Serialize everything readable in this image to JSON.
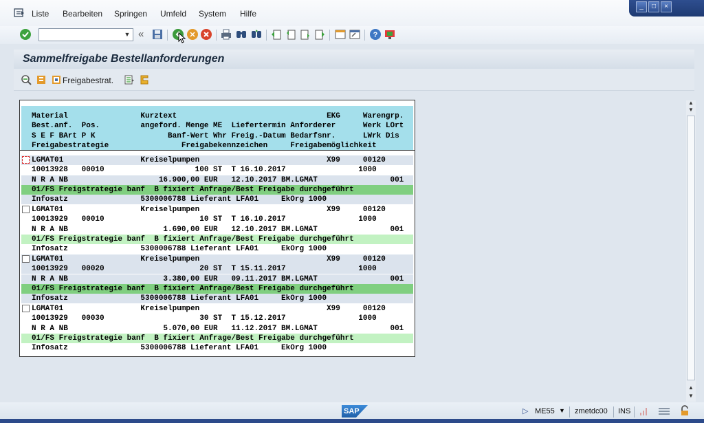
{
  "menu": {
    "items": [
      "Liste",
      "Bearbeiten",
      "Springen",
      "Umfeld",
      "System",
      "Hilfe"
    ]
  },
  "window_controls": [
    "minimize",
    "maximize",
    "close"
  ],
  "toolbar": {
    "command_field_value": "",
    "icons": [
      "check-icon",
      "save-icon",
      "back-icon",
      "exit-icon",
      "cancel-icon",
      "print-icon",
      "find-icon",
      "find-next-icon",
      "first-page-icon",
      "previous-page-icon",
      "next-page-icon",
      "last-page-icon",
      "new-session-icon",
      "shortcut-icon",
      "help-icon",
      "customize-icon"
    ]
  },
  "title": "Sammelfreigabe Bestellanforderungen",
  "app_toolbar": {
    "release_strategy_label": "Freigabestrat."
  },
  "list": {
    "header_lines": [
      "Material                Kurztext                                 EKG     Warengrp.",
      "Best.anf.  Pos.         angeford. Menge ME  Liefertermin Anforderer      Werk LOrt",
      "S E F BArt P K                Banf-Wert Whr Freig.-Datum Bedarfsnr.      LWrk Dis",
      "Freigabestrategie                Freigabekennzeichen     Freigabemöglichkeit"
    ],
    "items": [
      {
        "line1": "LGMAT01                 Kreiselpumpen                            X99     00120",
        "line2": "10013928   00010                    100 ST  T 16.10.2017                1000",
        "line3": "N R A NB                    16.900,00 EUR   12.10.2017 BM.LGMAT                001",
        "line4": "01/FS Freigstrategie banf  B fixiert Anfrage/Best Freigabe durchgeführt",
        "line5": "Infosatz                5300006788 Lieferant LFA01     EkOrg 1000",
        "strategy_style": "green",
        "focused": true
      },
      {
        "line1": "LGMAT01                 Kreiselpumpen                            X99     00120",
        "line2": "10013929   00010                     10 ST  T 16.10.2017                1000",
        "line3": "N R A NB                     1.690,00 EUR   12.10.2017 BM.LGMAT                001",
        "line4": "01/FS Freigstrategie banf  B fixiert Anfrage/Best Freigabe durchgeführt",
        "line5": "Infosatz                5300006788 Lieferant LFA01     EkOrg 1000",
        "strategy_style": "lgreen",
        "focused": false
      },
      {
        "line1": "LGMAT01                 Kreiselpumpen                            X99     00120",
        "line2": "10013929   00020                     20 ST  T 15.11.2017                1000",
        "line3": "N R A NB                     3.380,00 EUR   09.11.2017 BM.LGMAT                001",
        "line4": "01/FS Freigstrategie banf  B fixiert Anfrage/Best Freigabe durchgeführt",
        "line5": "Infosatz                5300006788 Lieferant LFA01     EkOrg 1000",
        "strategy_style": "green",
        "focused": false
      },
      {
        "line1": "LGMAT01                 Kreiselpumpen                            X99     00120",
        "line2": "10013929   00030                     30 ST  T 15.12.2017                1000",
        "line3": "N R A NB                     5.070,00 EUR   11.12.2017 BM.LGMAT                001",
        "line4": "01/FS Freigstrategie banf  B fixiert Anfrage/Best Freigabe durchgeführt",
        "line5": "Infosatz                5300006788 Lieferant LFA01     EkOrg 1000",
        "strategy_style": "lgreen",
        "focused": false
      }
    ]
  },
  "status": {
    "sap_logo": "SAP",
    "transaction": "ME55",
    "server": "zmetdc00",
    "mode": "INS"
  }
}
